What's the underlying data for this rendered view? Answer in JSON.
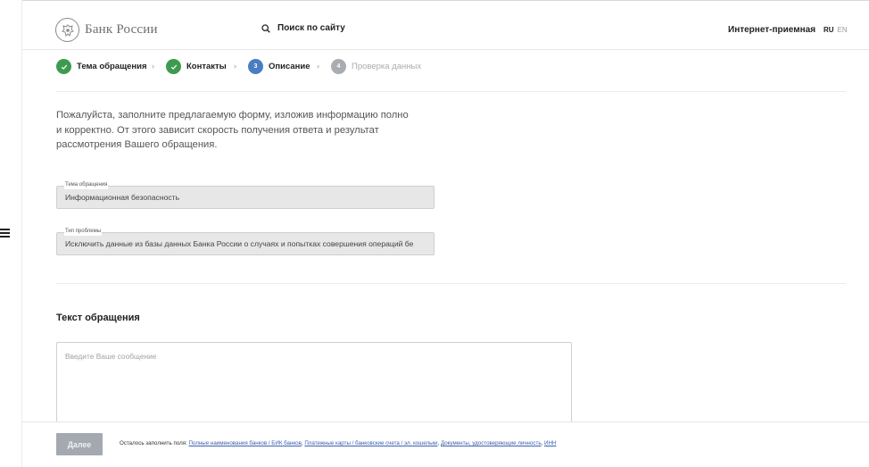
{
  "header": {
    "logo_text": "Банк России",
    "search_label": "Поиск по сайту",
    "reception_link": "Интернет-приемная",
    "lang_ru": "RU",
    "lang_en": "EN"
  },
  "stepper": {
    "steps": [
      {
        "label": "Тема обращения",
        "state": "done",
        "number": ""
      },
      {
        "label": "Контакты",
        "state": "done",
        "number": ""
      },
      {
        "label": "Описание",
        "state": "active",
        "number": "3"
      },
      {
        "label": "Проверка данных",
        "state": "future",
        "number": "4"
      }
    ],
    "colors": {
      "done": "#3d9b4f",
      "active": "#4a7ec2",
      "future": "#a9acb1"
    }
  },
  "intro": {
    "line1": "Пожалуйста, заполните предлагаемую форму, изложив информацию полно",
    "line2": "и корректно. От этого зависит скорость получения ответа и результат",
    "line3": "рассмотрения Вашего обращения."
  },
  "fields": {
    "topic": {
      "legend": "Тема обращения",
      "value": "Информационная безопасность"
    },
    "problem_type": {
      "legend": "Тип проблемы",
      "value": "Исключить данные из базы данных Банка России о случаях и попытках совершения операций бе"
    }
  },
  "message": {
    "title": "Текст обращения",
    "placeholder": "Введите Ваше сообщение",
    "value": ""
  },
  "footer": {
    "submit_label": "Далее",
    "remaining_prefix": "Осталось заполнить поля:",
    "links": [
      "Полные наименования банков / БИК банков",
      "Платежные карты / банковские счета / эл. кошельки",
      "Документы, удостоверяющие личность",
      "ИНН"
    ],
    "separator": ", "
  }
}
